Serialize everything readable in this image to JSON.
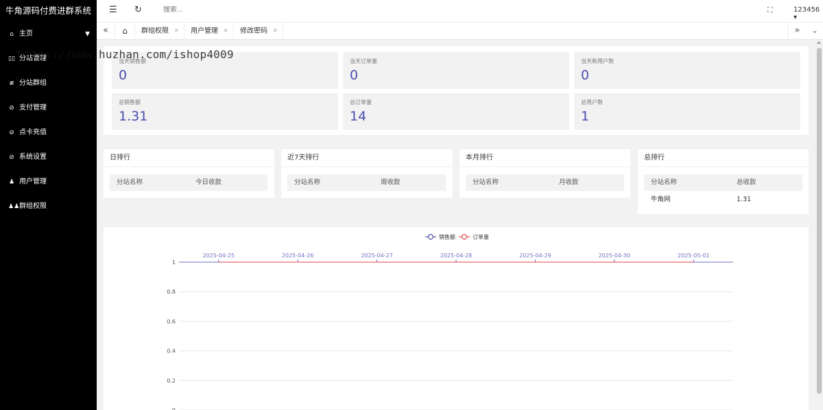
{
  "app_title": "牛角源码付费进群系统",
  "sidebar": {
    "items": [
      {
        "icon": "home-icon",
        "glyph": "⌂",
        "label": "主页",
        "has_caret": true
      },
      {
        "icon": "grid-icon",
        "glyph": "▯▯",
        "label": "分站管理",
        "has_caret": false
      },
      {
        "icon": "sliders-icon",
        "glyph": "≢",
        "label": "分站群组",
        "has_caret": false
      },
      {
        "icon": "check-circle-icon",
        "glyph": "⊘",
        "label": "支付管理",
        "has_caret": false
      },
      {
        "icon": "check-circle-icon",
        "glyph": "⊘",
        "label": "点卡充值",
        "has_caret": false
      },
      {
        "icon": "check-circle-icon",
        "glyph": "⊘",
        "label": "系统设置",
        "has_caret": false
      },
      {
        "icon": "user-icon",
        "glyph": "♟",
        "label": "用户管理",
        "has_caret": false
      },
      {
        "icon": "users-icon",
        "glyph": "♟♟",
        "label": "群组权限",
        "has_caret": false
      }
    ]
  },
  "header": {
    "menu_toggle_glyph": "☰",
    "refresh_glyph": "↻",
    "search_placeholder": "搜索...",
    "fullscreen_glyph": "⛶",
    "user": "123456 ▾"
  },
  "tabs": {
    "prev_glyph": "«",
    "home_glyph": "⌂",
    "items": [
      {
        "label": "群组权限"
      },
      {
        "label": "用户管理"
      },
      {
        "label": "修改密码"
      }
    ],
    "close_glyph": "×",
    "next_glyph": "»",
    "more_glyph": "⌄"
  },
  "watermark": "https://www.huzhan.com/ishop4009",
  "stats": [
    {
      "label": "当天销售额",
      "value": "0"
    },
    {
      "label": "当天订单量",
      "value": "0"
    },
    {
      "label": "当天新用户数",
      "value": "0"
    },
    {
      "label": "总销售额",
      "value": "1.31"
    },
    {
      "label": "总订单量",
      "value": "14"
    },
    {
      "label": "总用户数",
      "value": "1"
    }
  ],
  "rankings": [
    {
      "title": "日排行",
      "col1": "分站名称",
      "col2": "今日收款",
      "rows": []
    },
    {
      "title": "近7天排行",
      "col1": "分站名称",
      "col2": "周收款",
      "rows": []
    },
    {
      "title": "本月排行",
      "col1": "分站名称",
      "col2": "月收款",
      "rows": []
    },
    {
      "title": "总排行",
      "col1": "分站名称",
      "col2": "总收款",
      "rows": [
        {
          "name": "牛角网",
          "amount": "1.31"
        }
      ]
    }
  ],
  "colors": {
    "stat_value": "#4a4dae",
    "series_sales": "#4b4fa6",
    "series_orders": "#e2454b",
    "axis": "#6e70c3"
  },
  "chart_data": {
    "type": "line",
    "title": "",
    "legend_position": "top-center",
    "x_axis_position": "top",
    "x": [
      "2025-04-25",
      "2025-04-26",
      "2025-04-27",
      "2025-04-28",
      "2025-04-29",
      "2025-04-30",
      "2025-05-01"
    ],
    "ylim": [
      0,
      1
    ],
    "yticks": [
      "1",
      "0.8",
      "0.6",
      "0.4",
      "0.2",
      "0"
    ],
    "grid": true,
    "series": [
      {
        "name": "销售额",
        "values": [
          0,
          0,
          0,
          0,
          0,
          0,
          0
        ]
      },
      {
        "name": "订单量",
        "values": [
          0,
          0,
          0,
          0,
          0,
          0,
          0
        ]
      }
    ]
  }
}
